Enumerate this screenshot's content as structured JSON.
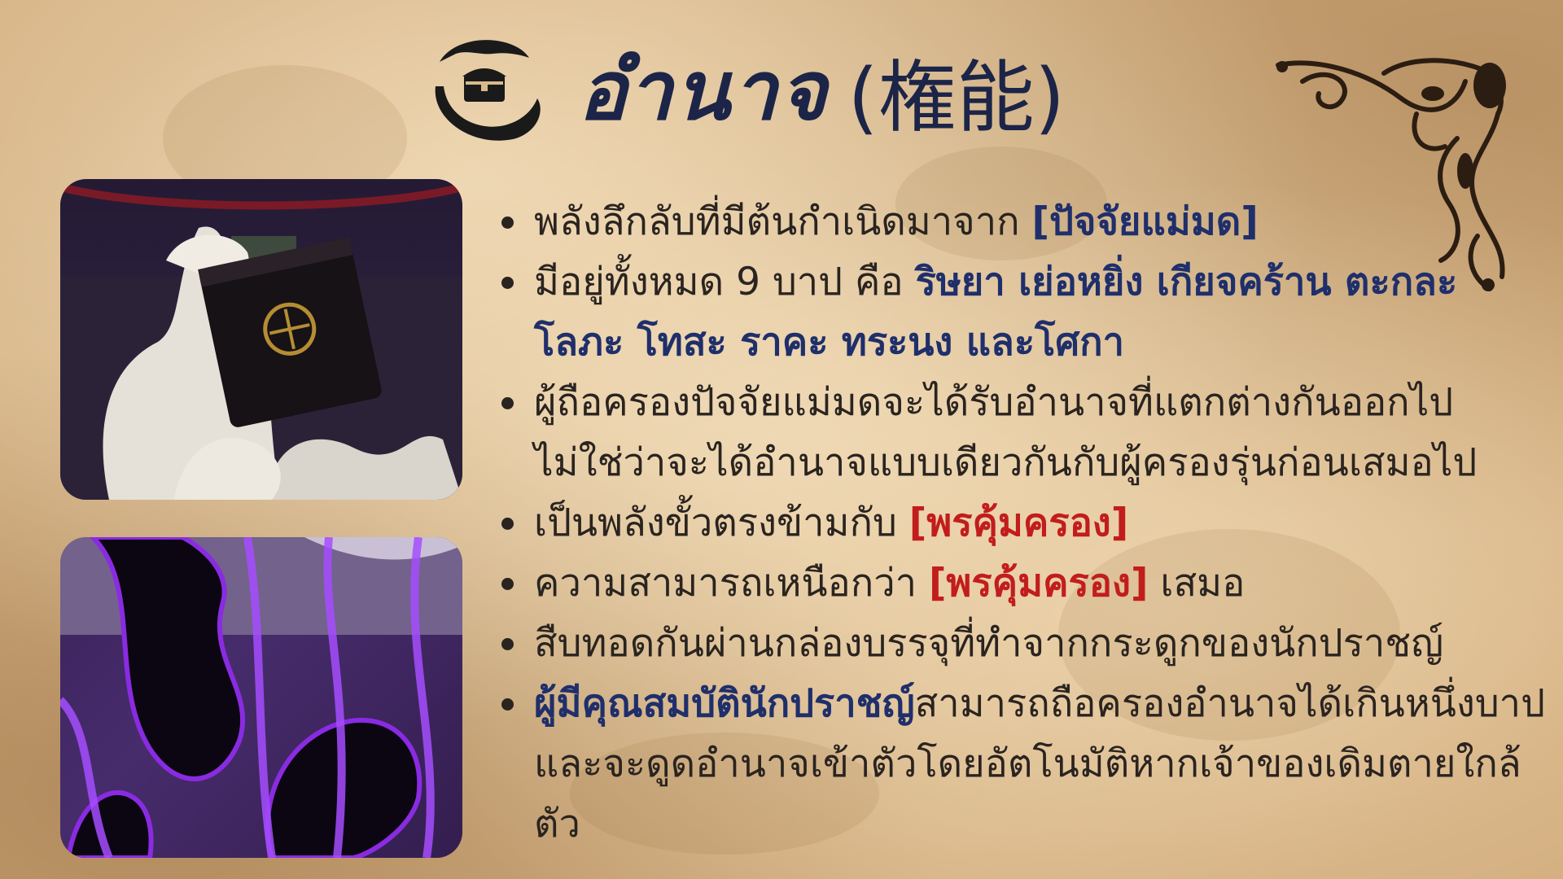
{
  "title": {
    "main": "อำนาจ",
    "kanji": "(権能)",
    "icon": "hands-holding-chest-icon"
  },
  "images": {
    "top": "hand-holding-black-box-image",
    "bottom": "purple-shadow-figure-image"
  },
  "bullets": [
    {
      "text_1": "พลังลึกลับที่มีต้นกำเนิดมาจาก",
      "highlight_1": "[ปัจจัยแม่มด]"
    },
    {
      "text_1": "มีอยู่ทั้งหมด 9 บาป คือ",
      "highlight_1": "ริษยา เย่อหยิ่ง เกียจคร้าน ตะกละ โลภะ โทสะ ราคะ ทระนง และโศกา"
    },
    {
      "text_1": "ผู้ถือครองปัจจัยแม่มดจะได้รับอำนาจที่แตกต่างกันออกไป ไม่ใช่ว่าจะได้อำนาจแบบเดียวกันกับผู้ครองรุ่นก่อนเสมอไป"
    },
    {
      "text_1": "เป็นพลังขั้วตรงข้ามกับ",
      "highlight_1": "[พรคุ้มครอง]"
    },
    {
      "text_1": "ความสามารถเหนือกว่า",
      "highlight_1": "[พรคุ้มครอง]",
      "text_2": "เสมอ"
    },
    {
      "text_1": "สืบทอดกันผ่านกล่องบรรจุที่ทำจากกระดูกของนักปราชญ์"
    },
    {
      "highlight_1": "ผู้มีคุณสมบัตินักปราชญ์",
      "text_1": "สามารถถือครองอำนาจได้เกินหนึ่งบาป และจะดูดอำนาจเข้าตัวโดยอัตโนมัติหากเจ้าของเดิมตายใกล้ตัว"
    }
  ],
  "colors": {
    "title": "#1c2548",
    "highlight_blue": "#1f2f6b",
    "highlight_red": "#c21d1d",
    "body_text": "#2a2420",
    "parchment": "#d9b98c"
  }
}
